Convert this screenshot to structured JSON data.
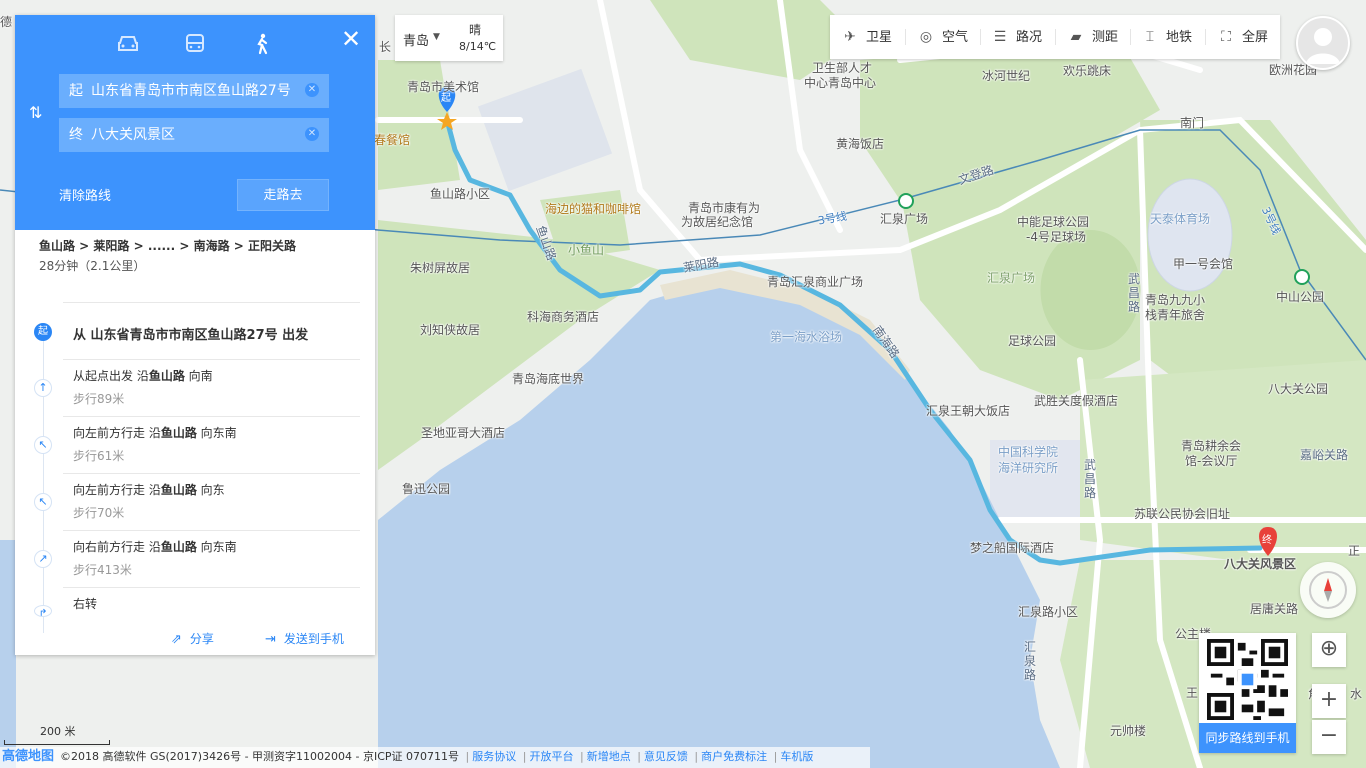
{
  "route_panel": {
    "modes": [
      "car-icon",
      "bus-icon",
      "walk-icon"
    ],
    "start_prefix": "起",
    "start_value": "山东省青岛市市南区鱼山路27号",
    "end_prefix": "终",
    "end_value": "八大关风景区",
    "clear_label": "清除路线",
    "go_label": "走路去",
    "summary": "鱼山路 > 莱阳路 > ...... > 南海路 > 正阳关路",
    "duration": "28分钟（2.1公里）",
    "start_badge": "起",
    "start_text": "从 山东省青岛市市南区鱼山路27号 出发",
    "steps": [
      {
        "pre": "从起点出发 沿",
        "road": "鱼山路",
        "post": " 向南",
        "dist": "步行89米",
        "icon": "straight-arrow-icon"
      },
      {
        "pre": "向左前方行走 沿",
        "road": "鱼山路",
        "post": " 向东南",
        "dist": "步行61米",
        "icon": "left-front-arrow-icon"
      },
      {
        "pre": "向左前方行走 沿",
        "road": "鱼山路",
        "post": " 向东",
        "dist": "步行70米",
        "icon": "left-front-arrow-icon"
      },
      {
        "pre": "向右前方行走 沿",
        "road": "鱼山路",
        "post": " 向东南",
        "dist": "步行413米",
        "icon": "right-front-arrow-icon"
      },
      {
        "pre": "右转",
        "road": "",
        "post": "",
        "dist": "",
        "icon": "right-turn-icon"
      }
    ],
    "share_label": "分享",
    "send_label": "发送到手机"
  },
  "weather": {
    "city": "青岛",
    "condition": "晴",
    "temp": "8/14℃"
  },
  "toolbar": [
    {
      "label": "卫星",
      "icon": "satellite-icon"
    },
    {
      "label": "空气",
      "icon": "air-icon"
    },
    {
      "label": "路况",
      "icon": "traffic-icon"
    },
    {
      "label": "测距",
      "icon": "ruler-icon"
    },
    {
      "label": "地铁",
      "icon": "subway-icon"
    },
    {
      "label": "全屏",
      "icon": "fullscreen-icon"
    }
  ],
  "qr": {
    "button": "同步路线到手机"
  },
  "scale": "200 米",
  "footer": {
    "logo": "高德地图",
    "copyright": "©2018 高德软件 GS(2017)3426号 - 甲测资字11002004 - 京ICP证 070711号",
    "links": [
      "服务协议",
      "开放平台",
      "新增地点",
      "意见反馈",
      "商户免费标注",
      "车机版"
    ]
  },
  "map_labels": {
    "art_museum": "青岛市美术馆",
    "restaurant": "春餐馆",
    "yushan_xiaoqu": "鱼山路小区",
    "cat_cafe": "海边的猫和咖啡馆",
    "kang_youwei": "青岛市康有为故居纪念馆",
    "kang_youwei_l1": "青岛市康有为",
    "kang_youwei_l2": "为故居纪念馆",
    "xiaoyushan": "小鱼山",
    "zhushuping": "朱树屏故居",
    "liuzhixia": "刘知侠故居",
    "kehai": "科海商务酒店",
    "aquarium": "青岛海底世界",
    "sandiego": "圣地亚哥大酒店",
    "luxun": "鲁迅公园",
    "laiyang": "莱阳路",
    "yushan_road": "鱼山路",
    "huiquan_mall": "青岛汇泉商业广场",
    "first_beach": "第一海水浴场",
    "nanhai": "南海路",
    "wenchang": "文登路",
    "line3": "3号线",
    "line3b": "3号线",
    "huiquan_square_station": "汇泉广场",
    "huiquan_square": "汇泉广场",
    "zhongneng": "中能足球公园-4号足球场",
    "zhongneng_l1": "中能足球公园",
    "zhongneng_l2": "-4号足球场",
    "tiantai": "天泰体育场",
    "jiayihao": "甲一号会馆",
    "nanmen": "南门",
    "zhongshan_park": "中山公园",
    "wusheng": "卫生部人才中心青岛中心",
    "wusheng_l1": "卫生部人才",
    "wusheng_l2": "中心青岛中心",
    "binghe": "冰河世纪",
    "huanle": "欢乐跳床",
    "huanghai": "黄海饭店",
    "oceanus": "欧洲花园",
    "jiujiu": "青岛九九小栈青年旅舍",
    "jiujiu_l1": "青岛九九小",
    "jiujiu_l2": "栈青年旅舍",
    "wuchang": "武昌路",
    "wuchang2": "武昌路",
    "football_park": "足球公园",
    "badaguan_park": "八大关公园",
    "wusheng_hotel": "武胜关度假酒店",
    "huiquan_wangchao": "汇泉王朝大饭店",
    "oceanology": "中国科学院海洋研究所",
    "oceanology_l1": "中国科学院",
    "oceanology_l2": "海洋研究所",
    "gengxin": "青岛耕余会馆-会议厅",
    "gengxin_l1": "青岛耕余会",
    "gengxin_l2": "馆-会议厅",
    "jiayu": "嘉峪关路",
    "sulian": "苏联公民协会旧址",
    "dream_ship": "梦之船国际酒店",
    "huiquan_xiaoqu": "汇泉路小区",
    "huiquan_road": "汇泉路",
    "badaguan": "八大关风景区",
    "juyong": "居庸关路",
    "gongzhu": "公主楼",
    "yuanshuai": "元帅楼",
    "zhengyang": "正",
    "jiao": "角",
    "shui": "水",
    "wang": "王",
    "river": "德",
    "chang": "长",
    "start_marker": "起",
    "end_marker": "终"
  },
  "colors": {
    "accent": "#3d93fd",
    "route": "#58b7e0",
    "sea": "#b7d0ec",
    "green": "#c9e0b2",
    "land": "#eef0ee"
  }
}
